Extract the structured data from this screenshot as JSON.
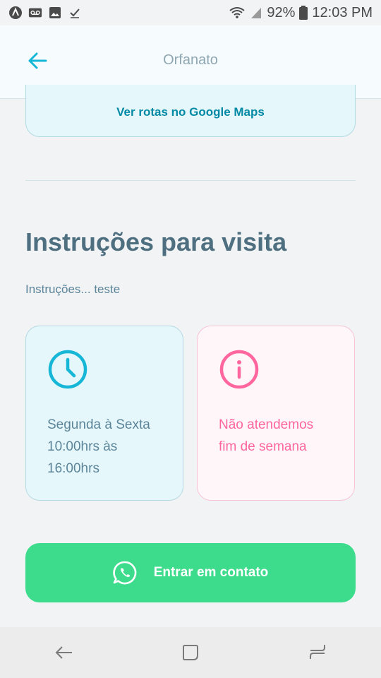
{
  "status_bar": {
    "battery": "92%",
    "time": "12:03 PM"
  },
  "header": {
    "title": "Orfanato"
  },
  "maps_button": {
    "label": "Ver rotas no Google Maps"
  },
  "instructions": {
    "title": "Instruções para visita",
    "description": "Instruções... teste"
  },
  "cards": {
    "hours": {
      "line1": "Segunda à Sexta",
      "line2": "10:00hrs às",
      "line3": "16:00hrs"
    },
    "weekend": {
      "line1": "Não atendemos",
      "line2": "fim de semana"
    }
  },
  "contact_button": {
    "label": "Entrar em contato"
  },
  "colors": {
    "primary": "#15c3d6",
    "blue_text": "#5c8599",
    "pink": "#ff669d",
    "green": "#3cdc8c"
  }
}
